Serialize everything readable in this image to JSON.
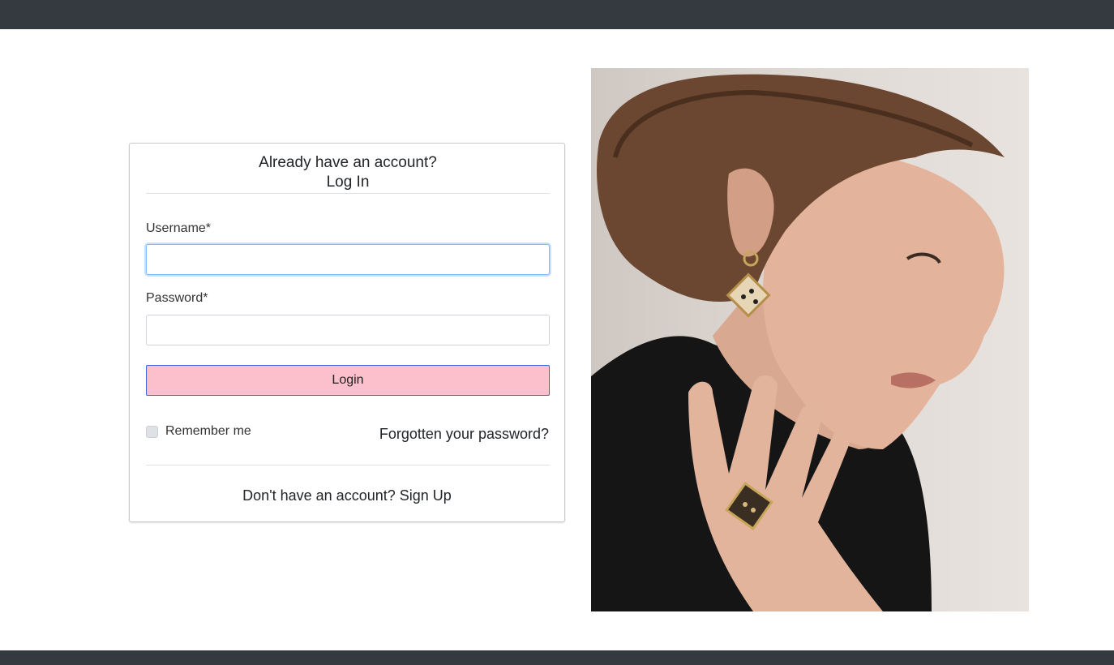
{
  "header": {
    "title_line1": "Already have an account?",
    "title_line2": "Log In"
  },
  "form": {
    "username_label": "Username*",
    "username_value": "",
    "password_label": "Password*",
    "password_value": "",
    "login_label": "Login",
    "remember_label": "Remember me",
    "remember_checked": false,
    "forgot_label": "Forgotten your password?"
  },
  "signup": {
    "prompt": "Don't have an account?",
    "link_label": "Sign Up"
  },
  "colors": {
    "topbar": "#343a40",
    "login_button": "#fbc0cb",
    "login_border": "#3a63d6"
  }
}
